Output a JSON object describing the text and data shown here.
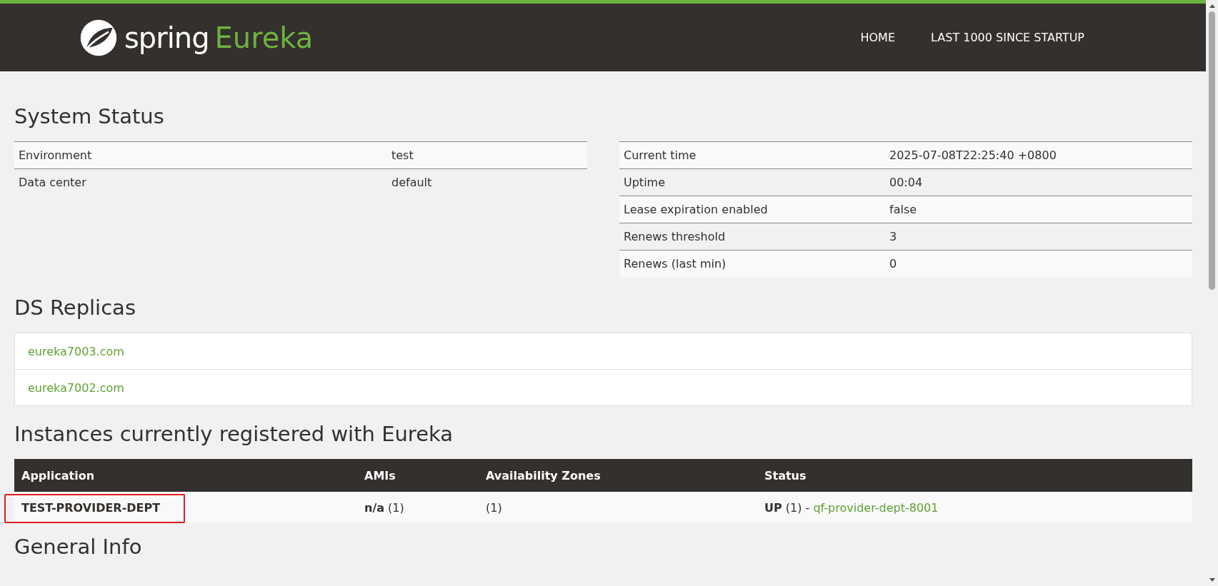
{
  "header": {
    "logo_word": "spring",
    "logo_product": "Eureka",
    "nav": [
      "HOME",
      "LAST 1000 SINCE STARTUP"
    ]
  },
  "system_status": {
    "title": "System Status",
    "left_table": [
      {
        "label": "Environment",
        "value": "test"
      },
      {
        "label": "Data center",
        "value": "default"
      }
    ],
    "right_table": [
      {
        "label": "Current time",
        "value": "2025-07-08T22:25:40 +0800"
      },
      {
        "label": "Uptime",
        "value": "00:04"
      },
      {
        "label": "Lease expiration enabled",
        "value": "false"
      },
      {
        "label": "Renews threshold",
        "value": "3"
      },
      {
        "label": "Renews (last min)",
        "value": "0"
      }
    ]
  },
  "ds_replicas": {
    "title": "DS Replicas",
    "items": [
      "eureka7003.com",
      "eureka7002.com"
    ]
  },
  "instances": {
    "title": "Instances currently registered with Eureka",
    "columns": [
      "Application",
      "AMIs",
      "Availability Zones",
      "Status"
    ],
    "rows": [
      {
        "application": "TEST-PROVIDER-DEPT",
        "highlighted": true,
        "amis": "**n/a** (1)",
        "zones": "(1)",
        "status": "**UP** (1) -",
        "instance_link": "qf-provider-dept-8001"
      }
    ]
  },
  "general_info": {
    "title": "General Info"
  }
}
